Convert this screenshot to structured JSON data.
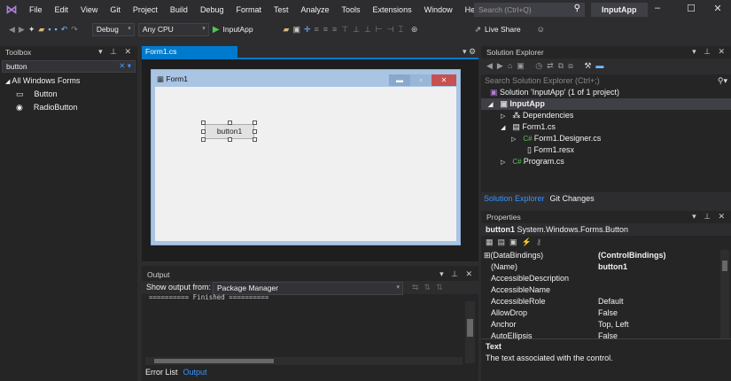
{
  "menu": {
    "items": [
      "File",
      "Edit",
      "View",
      "Git",
      "Project",
      "Build",
      "Debug",
      "Format",
      "Test",
      "Analyze",
      "Tools",
      "Extensions",
      "Window",
      "Help"
    ],
    "search_placeholder": "Search (Ctrl+Q)",
    "app_title": "InputApp"
  },
  "toolbar": {
    "configuration": "Debug",
    "platform": "Any CPU",
    "start_target": "InputApp",
    "live_share": "Live Share"
  },
  "toolbox": {
    "title": "Toolbox",
    "search_value": "button",
    "group": "All Windows Forms",
    "items": [
      "Button",
      "RadioButton"
    ]
  },
  "document": {
    "tab_label": "Form1.cs [Design]*",
    "form_title": "Form1",
    "button_text": "button1"
  },
  "output": {
    "title": "Output",
    "show_from_label": "Show output from:",
    "source": "Package Manager",
    "text": "========== Finished ==========",
    "tabs": [
      "Error List",
      "Output"
    ]
  },
  "solution_explorer": {
    "title": "Solution Explorer",
    "search_placeholder": "Search Solution Explorer (Ctrl+;)",
    "tree": [
      "Solution 'InputApp' (1 of 1 project)",
      "InputApp",
      "Dependencies",
      "Form1.cs",
      "Form1.Designer.cs",
      "Form1.resx",
      "Program.cs"
    ],
    "tabs": [
      "Solution Explorer",
      "Git Changes"
    ]
  },
  "properties": {
    "title": "Properties",
    "object_name": "button1",
    "object_type": "System.Windows.Forms.Button",
    "rows": [
      {
        "name": "(DataBindings)",
        "value": "(ControlBindings)"
      },
      {
        "name": "(Name)",
        "value": "button1"
      },
      {
        "name": "AccessibleDescription",
        "value": ""
      },
      {
        "name": "AccessibleName",
        "value": ""
      },
      {
        "name": "AccessibleRole",
        "value": "Default"
      },
      {
        "name": "AllowDrop",
        "value": "False"
      },
      {
        "name": "Anchor",
        "value": "Top, Left"
      },
      {
        "name": "AutoEllipsis",
        "value": "False"
      }
    ],
    "desc_title": "Text",
    "desc_text": "The text associated with the control."
  },
  "colors": {
    "accent": "#007acc",
    "bg": "#2d2d30",
    "panel": "#252526"
  }
}
